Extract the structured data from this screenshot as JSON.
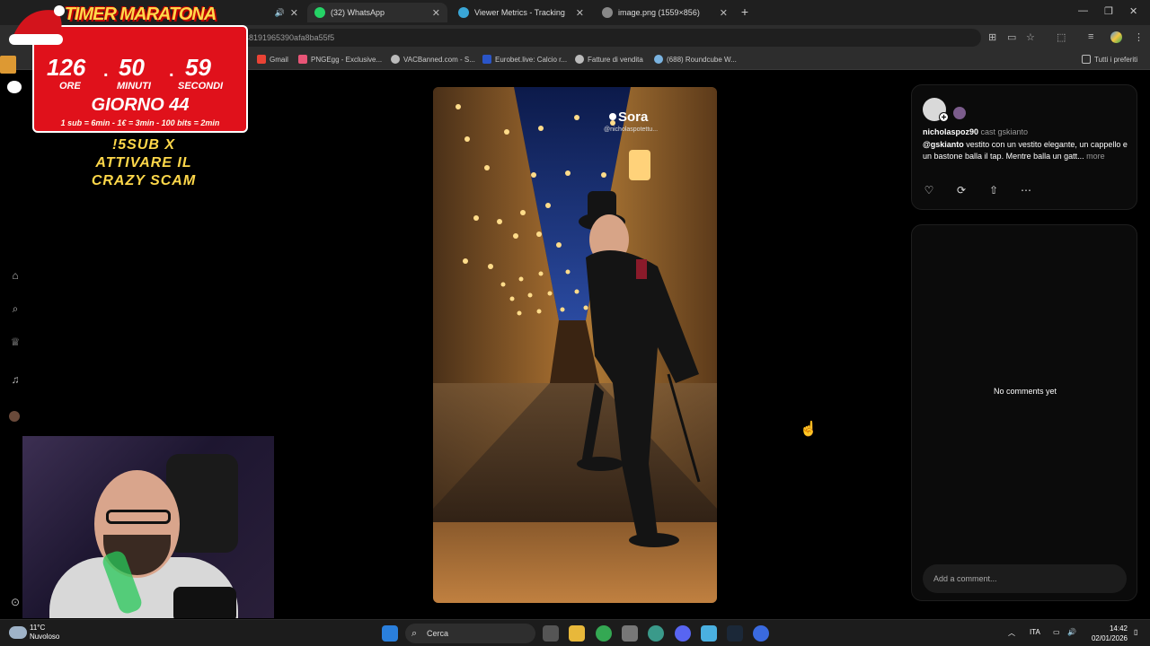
{
  "browser": {
    "tabs": [
      {
        "label": "(32) WhatsApp",
        "fav_color": "#25d366"
      },
      {
        "label": "Viewer Metrics - Tracking",
        "fav_color": "#3aa6d6"
      },
      {
        "label": "image.png (1559×856)",
        "fav_color": "#aaaaaa"
      }
    ],
    "address_partial": "48191965390afa8ba55f5",
    "bookmarks": [
      {
        "label": "Gmail",
        "color": "#ea4335"
      },
      {
        "label": "PNGEgg - Exclusive...",
        "color": "#e85577"
      },
      {
        "label": "VACBanned.com - S...",
        "color": "#bbbbbb"
      },
      {
        "label": "Eurobet.live: Calcio r...",
        "color": "#2a55c8"
      },
      {
        "label": "Fatture di vendita",
        "color": "#bbbbbb"
      },
      {
        "label": "(688) Roundcube W...",
        "color": "#7ab3e0"
      }
    ],
    "all_bookmarks": "Tutti i preferiti"
  },
  "overlay": {
    "title": "TIMER MARATONA",
    "hours": "126",
    "hours_label": "ORE",
    "minutes": "50",
    "minutes_label": "MINUTI",
    "seconds": "59",
    "seconds_label": "SECONDI",
    "day": "GIORNO 44",
    "rates": "1 sub = 6min - 1€ = 3min - 100 bits = 2min",
    "promo_line1": "!5SUB X",
    "promo_line2": "ATTIVARE IL",
    "promo_line3": "CRAZY SCAM"
  },
  "video": {
    "watermark": "Sora",
    "watermark_handle": "@nicholaspotettu..."
  },
  "post": {
    "username": "nicholaspoz90",
    "cast_label": "cast gskianto",
    "mention": "@gskianto",
    "description": " vestito con un vestito elegante, un cappello e un bastone balla il tap. Mentre balla un gatt...",
    "more": "more"
  },
  "comments": {
    "empty": "No comments yet",
    "placeholder": "Add a comment..."
  },
  "taskbar": {
    "temp": "11°C",
    "condition": "Nuvoloso",
    "search": "Cerca",
    "lang": "ITA",
    "time": "14:42",
    "date": "02/01/2026"
  }
}
